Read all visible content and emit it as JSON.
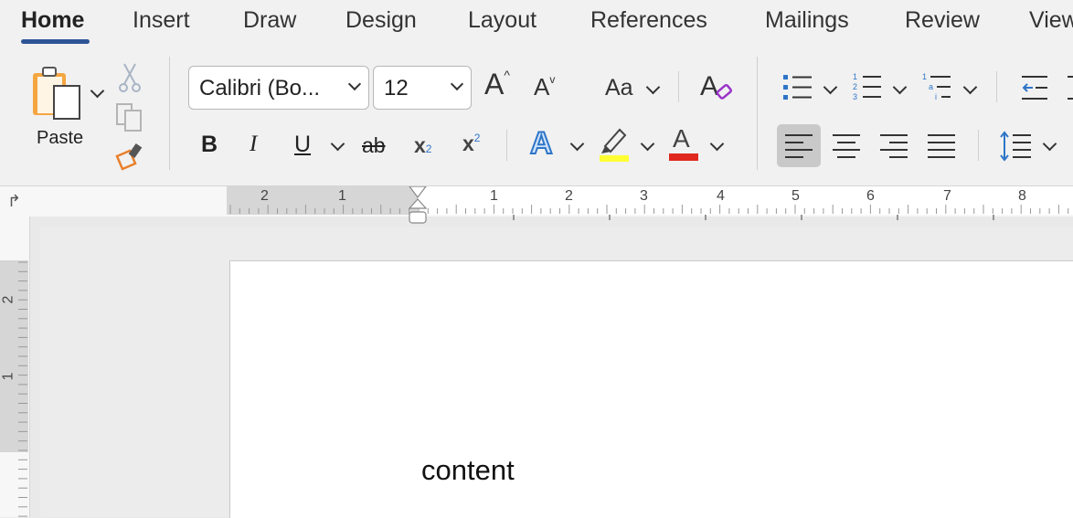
{
  "tabs": [
    {
      "label": "Home",
      "active": true
    },
    {
      "label": "Insert"
    },
    {
      "label": "Draw"
    },
    {
      "label": "Design"
    },
    {
      "label": "Layout"
    },
    {
      "label": "References"
    },
    {
      "label": "Mailings"
    },
    {
      "label": "Review"
    },
    {
      "label": "View"
    }
  ],
  "clipboard": {
    "paste_label": "Paste"
  },
  "font": {
    "name": "Calibri (Bo...",
    "size": "12",
    "change_case": "Aa"
  },
  "colors": {
    "accent": "#2f5496",
    "highlight": "#ffff33",
    "font_color": "#e0281e",
    "text_effect": "#2e75c8",
    "clear_format": "#9b34c8"
  },
  "ruler": {
    "horizontal_labels": [
      "2",
      "1",
      "1",
      "2",
      "3",
      "4",
      "5",
      "6",
      "7",
      "8"
    ],
    "vertical_labels": [
      "2",
      "1"
    ]
  },
  "document": {
    "text": "content"
  },
  "icons": {
    "paste": "clipboard-icon",
    "cut": "scissors-icon",
    "copy": "copy-icon",
    "format_painter": "paintbrush-icon",
    "bold": "B",
    "italic": "I",
    "underline": "U",
    "strike": "ab",
    "subscript": "x2",
    "superscript": "x2",
    "text_effects": "text-effects-icon",
    "highlight": "highlighter-icon",
    "font_color": "font-color-icon",
    "bullets": "bullets-icon",
    "numbering": "numbering-icon",
    "multilevel": "multilevel-list-icon",
    "align_left": "align-left-icon",
    "center": "align-center-icon",
    "align_right": "align-right-icon",
    "justify": "justify-icon",
    "line_spacing": "line-spacing-icon",
    "decrease_indent": "decrease-indent-icon"
  }
}
